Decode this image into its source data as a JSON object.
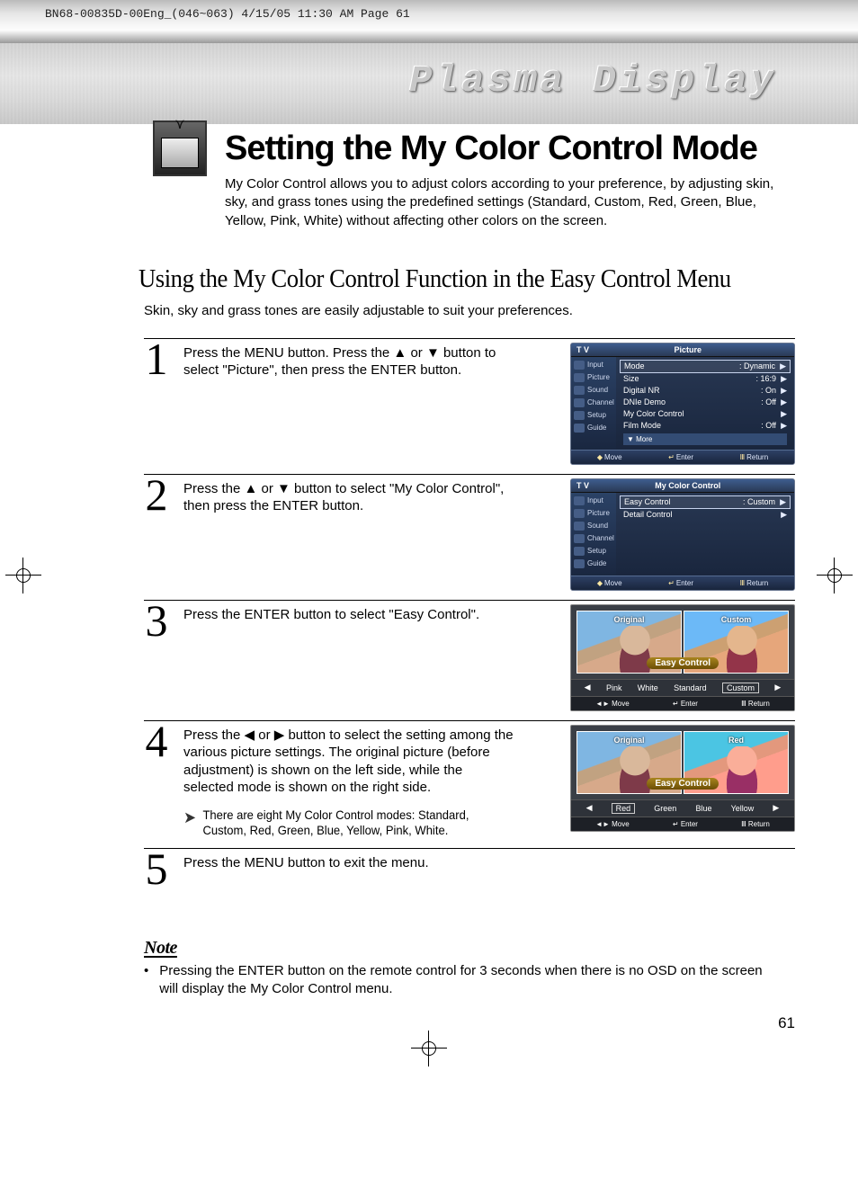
{
  "print_header": "BN68-00835D-00Eng_(046~063)  4/15/05  11:30 AM  Page 61",
  "brand": "Plasma Display",
  "title": "Setting the My Color Control Mode",
  "intro": "My Color Control allows you to adjust colors according to your preference, by adjusting skin, sky, and grass tones using the predefined settings (Standard, Custom, Red, Green, Blue, Yellow, Pink, White) without affecting other colors on the screen.",
  "section": "Using the My Color Control Function in the Easy Control Menu",
  "sub": "Skin, sky and grass tones are easily adjustable to suit your preferences.",
  "steps": {
    "s1": {
      "num": "1",
      "text": "Press the MENU button. Press the ▲ or ▼ button to select \"Picture\", then press the ENTER button."
    },
    "s2": {
      "num": "2",
      "text": "Press the ▲ or ▼ button to select \"My Color Control\", then press the ENTER button."
    },
    "s3": {
      "num": "3",
      "text": "Press the ENTER button to select \"Easy Control\"."
    },
    "s4": {
      "num": "4",
      "text": "Press the ◀ or ▶ button to select the setting among the various picture settings. The original picture (before adjustment) is shown on the left side, while the selected mode is shown on the right side."
    },
    "s4_callout": "There are eight My Color Control modes: Standard, Custom, Red, Green, Blue, Yellow, Pink, White.",
    "s5": {
      "num": "5",
      "text": "Press the MENU button to exit the menu."
    }
  },
  "osd_side": [
    "Input",
    "Picture",
    "Sound",
    "Channel",
    "Setup",
    "Guide"
  ],
  "osd1": {
    "tv": "T V",
    "title": "Picture",
    "rows": [
      {
        "k": "Mode",
        "v": ": Dynamic"
      },
      {
        "k": "Size",
        "v": ": 16:9"
      },
      {
        "k": "Digital NR",
        "v": ": On"
      },
      {
        "k": "DNIe Demo",
        "v": ": Off"
      },
      {
        "k": "My Color Control",
        "v": ""
      },
      {
        "k": "Film Mode",
        "v": ": Off"
      }
    ],
    "more": "▼ More"
  },
  "osd2": {
    "tv": "T V",
    "title": "My Color Control",
    "rows": [
      {
        "k": "Easy Control",
        "v": ": Custom"
      },
      {
        "k": "Detail Control",
        "v": ""
      }
    ]
  },
  "osd_footer": {
    "move": "Move",
    "enter": "Enter",
    "ret": "Return"
  },
  "preview3": {
    "left": "Original",
    "right": "Custom",
    "overlay": "Easy Control",
    "opts": [
      "Pink",
      "White",
      "Standard",
      "Custom"
    ]
  },
  "preview4": {
    "left": "Original",
    "right": "Red",
    "overlay": "Easy Control",
    "opts": [
      "Red",
      "Green",
      "Blue",
      "Yellow"
    ]
  },
  "preview_footer": {
    "move": "Move",
    "enter": "Enter",
    "ret": "Return"
  },
  "note": {
    "heading": "Note",
    "bullet": "•",
    "text": "Pressing the ENTER button on the remote control for 3 seconds when there is no OSD on the screen will display the My Color Control menu."
  },
  "page_num": "61"
}
